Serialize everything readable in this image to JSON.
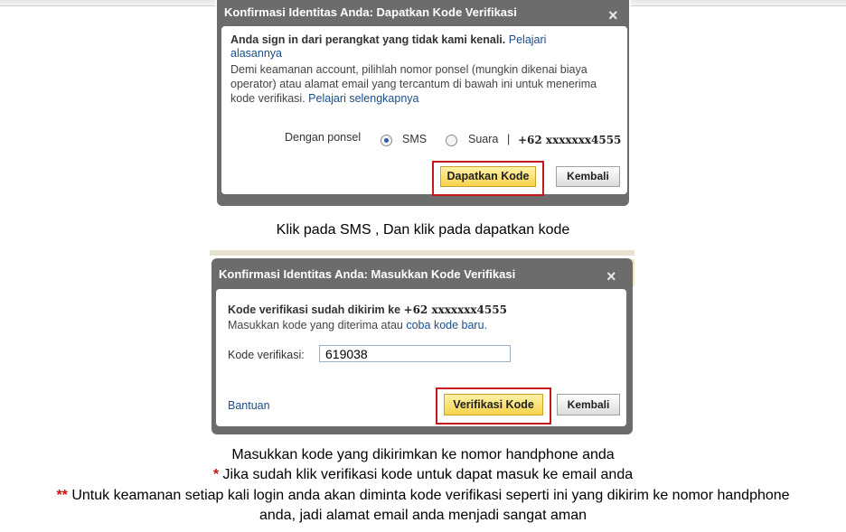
{
  "dialog1": {
    "title": "Konfirmasi Identitas Anda: Dapatkan Kode Verifikasi",
    "close_glyph": "×",
    "bold_text": "Anda sign in dari perangkat yang tidak kami kenali.",
    "learn_why_link": "Pelajari alasannya",
    "description": "Demi keamanan account, pilihlah nomor ponsel (mungkin dikenai biaya operator) atau alamat email yang tercantum di bawah ini untuk menerima kode verifikasi.",
    "learn_more_link": "Pelajari selengkapnya",
    "phone_label": "Dengan ponsel",
    "option_sms": "SMS",
    "option_voice": "Suara",
    "separator": "|",
    "phone_number": "+62 xxxxxxx4555",
    "get_code_button": "Dapatkan Kode",
    "back_button": "Kembali"
  },
  "caption1": "Klik pada SMS , Dan klik pada dapatkan kode",
  "dialog2": {
    "title": "Konfirmasi Identitas Anda: Masukkan Kode Verifikasi",
    "close_glyph": "×",
    "sent_text": "Kode verifikasi sudah dikirim ke",
    "phone_number": "+62 xxxxxxx4555",
    "enter_text": "Masukkan kode yang diterima atau",
    "new_code_link": "coba kode baru.",
    "code_label": "Kode verifikasi:",
    "code_value": "619038",
    "help_link": "Bantuan",
    "verify_button": "Verifikasi Kode",
    "back_button": "Kembali"
  },
  "captions": {
    "line1": "Masukkan kode yang dikirimkan ke nomor handphone anda",
    "line2_marker": "*",
    "line2": " Jika sudah klik verifikasi kode untuk dapat masuk ke email anda",
    "line3_marker": "**",
    "line3": " Untuk keamanan setiap kali login anda akan diminta kode verifikasi seperti ini yang dikirim ke nomor handphone",
    "line4": "anda, jadi alamat email anda menjadi sangat aman"
  },
  "colors": {
    "dialog_frame": "#6c6c6c",
    "link": "#1a4d8a",
    "highlight_outline": "#c8171a",
    "primary_button": "#f7d24a",
    "marker": "#d01010"
  }
}
